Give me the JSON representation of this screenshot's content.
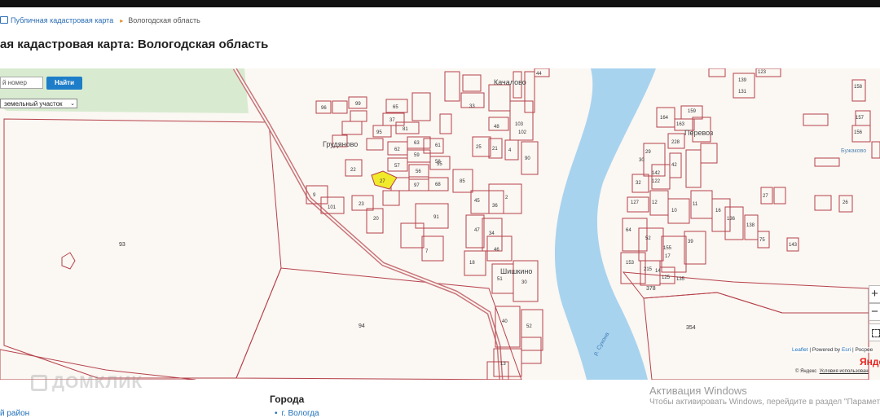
{
  "breadcrumb": {
    "link": "Публичная кадастровая карта",
    "current": "Вологодская область"
  },
  "page_title": "ая кадастровая карта: Вологодская область",
  "search": {
    "input_value": "й номер",
    "button_label": "Найти",
    "type_select": "земельный участок"
  },
  "map": {
    "places": [
      "Качалово",
      "Грудяново",
      "Перевоз",
      "Шишкино",
      "Бужаково"
    ],
    "river_label": "р. Сухона",
    "big_parcels": [
      "93",
      "94",
      "354",
      "378"
    ],
    "parcels": [
      "96",
      "99",
      "65",
      "37",
      "81",
      "95",
      "62",
      "59",
      "58",
      "63",
      "61",
      "57",
      "56",
      "55",
      "27",
      "22",
      "97",
      "68",
      "91",
      "101",
      "23",
      "9",
      "20",
      "85",
      "33",
      "103",
      "102",
      "90",
      "48",
      "44",
      "25",
      "21",
      "4",
      "7",
      "2",
      "36",
      "45",
      "47",
      "34",
      "18",
      "46",
      "51",
      "30",
      "40",
      "52",
      "13",
      "14",
      "17",
      "135",
      "125",
      "215",
      "155",
      "153",
      "64",
      "52",
      "39",
      "16",
      "12",
      "10",
      "11",
      "136",
      "138",
      "75",
      "143",
      "139",
      "131",
      "123",
      "158",
      "157",
      "156",
      "159",
      "164",
      "163",
      "228",
      "29",
      "30",
      "32",
      "127",
      "142",
      "122",
      "42",
      "27",
      "26",
      "41",
      "111",
      "96"
    ],
    "colors": {
      "background": "#fbf7f3",
      "parcel_line": "#b5414a",
      "road": "#c9767a",
      "river": "#a8d3ee",
      "forest": "#d8ebd0",
      "selected_parcel": "#f0ea2a",
      "accent": "#1e7dc8"
    },
    "controls": {
      "zoom_in": "+",
      "zoom_out": "−",
      "fullscreen_icon": "fullscreen-icon"
    },
    "attribution": {
      "leaflet": "Leaflet",
      "separator": " | Powered by ",
      "esri": "Esri",
      "rest": " | Росрее"
    },
    "yandex_logo": "Янде",
    "yandex_copy": "© Яндекс",
    "yandex_terms": "Условия использован"
  },
  "watermark": "ДОМКЛИК",
  "windows_activation": {
    "title": "Активация Windows",
    "text": "Чтобы активировать Windows, перейдите в раздел \"Параметры\""
  },
  "footer": {
    "district_link": "й район",
    "cities_heading": "Города",
    "city_link": "г. Вологда"
  }
}
